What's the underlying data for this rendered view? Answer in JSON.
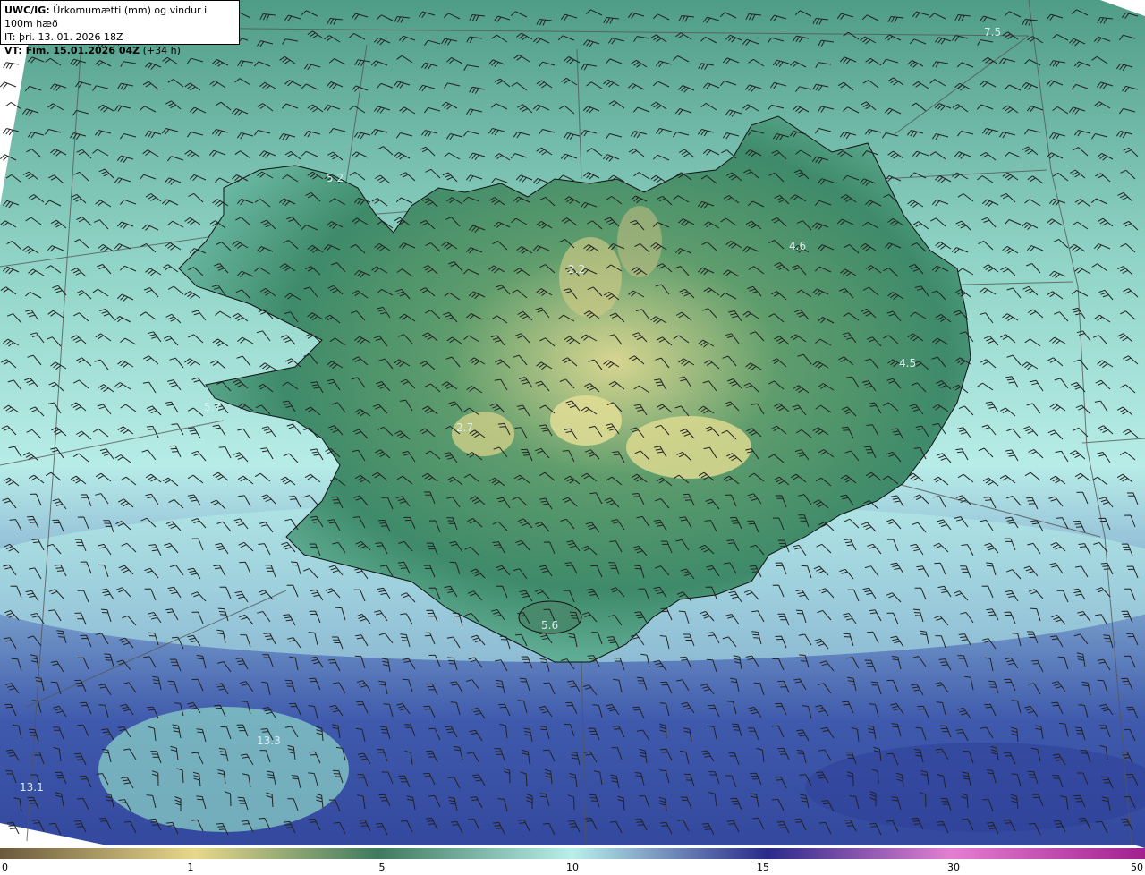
{
  "header": {
    "model": "UWC/IG:",
    "description": "Úrkomumætti (mm) og vindur i 100m hæð",
    "it_label": "IT:",
    "it_value": "þri. 13. 01. 2026 18Z",
    "vt_label": "VT: Fim. 15.01.2026 04Z",
    "vt_offset": "(+34 h)"
  },
  "map_values": [
    "5.2",
    "7.5",
    "2.2",
    "4.6",
    "4.5",
    "5.7",
    "2.7",
    "5.6",
    "13.3",
    "13.1"
  ],
  "colorbar": {
    "ticks": [
      "0",
      "1",
      "5",
      "10",
      "15",
      "30",
      "50"
    ],
    "colors": [
      "#6b5a3c",
      "#e8d88a",
      "#3f7a5f",
      "#b8efea",
      "#2a2a8a",
      "#e47fd0",
      "#a0208f"
    ]
  },
  "icons": {
    "wind": "wind-barb-icon"
  }
}
